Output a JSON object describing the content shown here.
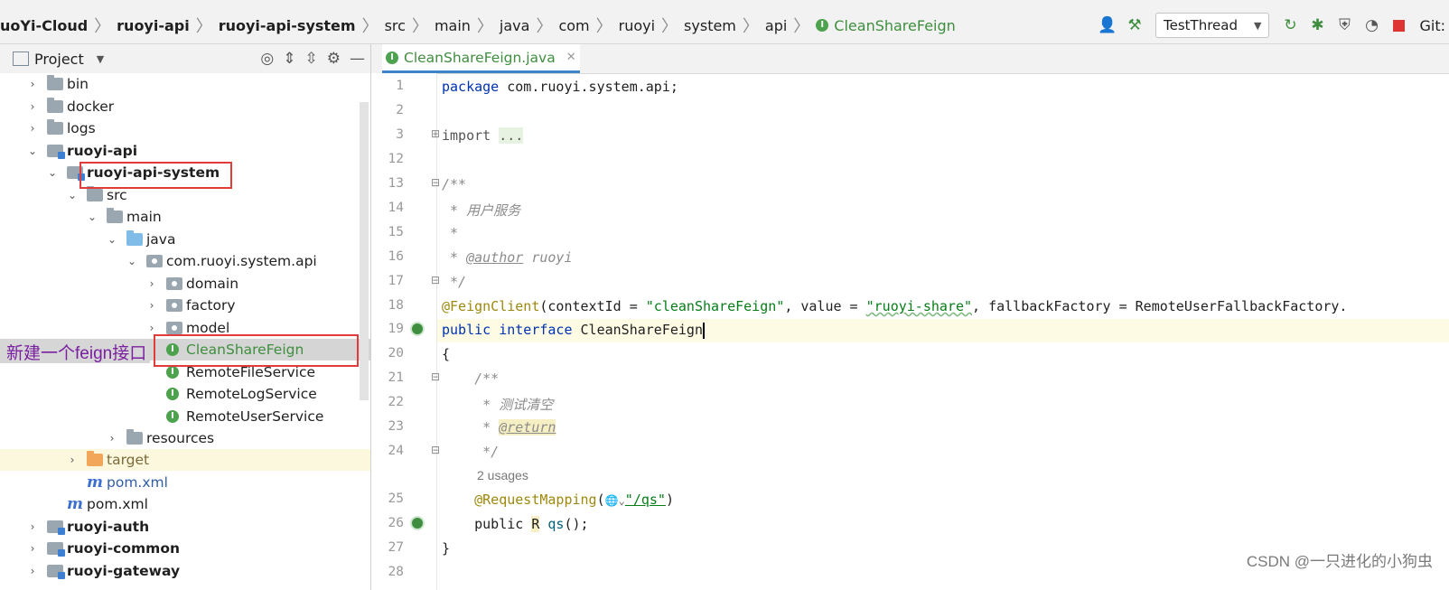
{
  "breadcrumb": [
    "uoYi-Cloud",
    "ruoyi-api",
    "ruoyi-api-system",
    "src",
    "main",
    "java",
    "com",
    "ruoyi",
    "system",
    "api",
    "CleanShareFeign"
  ],
  "toolbar": {
    "run_config": "TestThread",
    "git_label": "Git:"
  },
  "project_panel": {
    "title": "Project"
  },
  "tree": [
    {
      "label": "bin",
      "kind": "folder"
    },
    {
      "label": "docker",
      "kind": "folder"
    },
    {
      "label": "logs",
      "kind": "folder"
    },
    {
      "label": "ruoyi-api",
      "kind": "module"
    },
    {
      "label": "ruoyi-api-system",
      "kind": "module"
    },
    {
      "label": "src",
      "kind": "folder"
    },
    {
      "label": "main",
      "kind": "folder"
    },
    {
      "label": "java",
      "kind": "source-folder"
    },
    {
      "label": "com.ruoyi.system.api",
      "kind": "package"
    },
    {
      "label": "domain",
      "kind": "package"
    },
    {
      "label": "factory",
      "kind": "package"
    },
    {
      "label": "model",
      "kind": "package"
    },
    {
      "label": "CleanShareFeign",
      "kind": "interface"
    },
    {
      "label": "RemoteFileService",
      "kind": "interface"
    },
    {
      "label": "RemoteLogService",
      "kind": "interface"
    },
    {
      "label": "RemoteUserService",
      "kind": "interface"
    },
    {
      "label": "resources",
      "kind": "folder"
    },
    {
      "label": "target",
      "kind": "excluded-folder"
    },
    {
      "label": "pom.xml",
      "kind": "maven"
    },
    {
      "label": "pom.xml",
      "kind": "maven"
    },
    {
      "label": "ruoyi-auth",
      "kind": "module"
    },
    {
      "label": "ruoyi-common",
      "kind": "module"
    },
    {
      "label": "ruoyi-gateway",
      "kind": "module"
    }
  ],
  "annotation_note": "新建一个feign接口",
  "editor": {
    "tab_title": "CleanShareFeign.java",
    "line_numbers": [
      "1",
      "2",
      "3",
      "12",
      "13",
      "14",
      "15",
      "16",
      "17",
      "18",
      "19",
      "20",
      "21",
      "22",
      "23",
      "24",
      "25",
      "26",
      "27",
      "28"
    ],
    "code": {
      "l1_kw": "package",
      "l1_rest": " com.ruoyi.system.api;",
      "l3_kw": "import",
      "l3_fold": "...",
      "l13": "/**",
      "l14": " * 用户服务",
      "l15": " *",
      "l16_pre": " * ",
      "l16_tag": "@author",
      "l16_post": " ruoyi",
      "l17": " */",
      "l18_ann": "@FeignClient",
      "l18_a": "(contextId = ",
      "l18_s1": "\"cleanShareFeign\"",
      "l18_b": ", value = ",
      "l18_s2": "\"ruoyi-share\"",
      "l18_c": ", fallbackFactory = RemoteUserFallbackFactory.",
      "l19_kw1": "public",
      "l19_kw2": "interface",
      "l19_name": "CleanShareFeign",
      "l20": "{",
      "l21": "    /**",
      "l22": "     * 测试清空",
      "l23_pre": "     * ",
      "l23_tag": "@return",
      "l24": "     */",
      "usages": "2 usages",
      "l25_ann": "@RequestMapping",
      "l25_open": "(",
      "l25_str": "\"/qs\"",
      "l25_close": ")",
      "l26_pre": "    public ",
      "l26_type": "R",
      "l26_fn": " qs",
      "l26_post": "();",
      "l27": "}"
    }
  },
  "watermark": "CSDN @一只进化的小狗虫",
  "colors": {
    "accent": "#4083c9",
    "interface_green": "#3f8e3f",
    "highlight_box": "#e23b3b",
    "note_text": "#7a1fa0"
  }
}
